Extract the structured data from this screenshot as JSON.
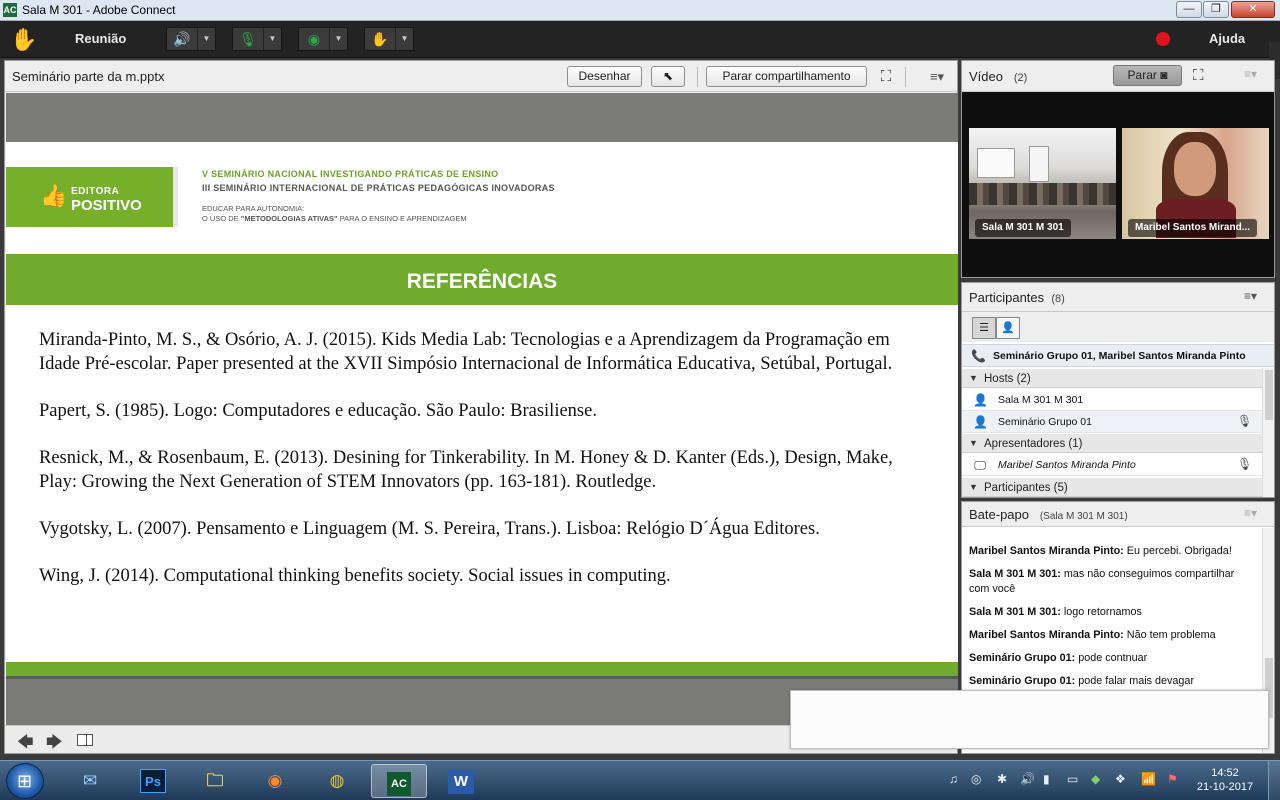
{
  "window": {
    "icon_text": "AC",
    "title": "Sala M 301 - Adobe Connect",
    "minimize": "—",
    "maximize": "❐",
    "close": "✕"
  },
  "menubar": {
    "meeting_menu": "Reunião",
    "help_menu": "Ajuda",
    "icons": [
      "speaker-icon",
      "microphone-icon",
      "webcam-icon",
      "raise-hand-icon"
    ],
    "accent": "#2ea84a",
    "record_color": "#e0141e"
  },
  "share_pod": {
    "title": "Seminário parte da m.pptx",
    "draw_button": "Desenhar",
    "stop_sharing_button": "Parar compartilhamento",
    "slide": {
      "logo_top": "EDITORA",
      "logo_bottom": "POSITIVO",
      "header_line1": "V SEMINÁRIO NACIONAL INVESTIGANDO PRÁTICAS DE ENSINO",
      "header_line2": "III SEMINÁRIO INTERNACIONAL DE PRÁTICAS PEDAGÓGICAS INOVADORAS",
      "header_line3": "EDUCAR PARA AUTONOMIA:",
      "header_line4_pre": "O USO DE ",
      "header_line4_bold": "\"METODOLOGIAS ATIVAS\"",
      "header_line4_post": " PARA O ENSINO E APRENDIZAGEM",
      "section_title": "REFERÊNCIAS",
      "references": [
        "Miranda-Pinto, M. S., & Osório, A. J. (2015). Kids Media Lab: Tecnologias e a Aprendizagem da Programação em Idade Pré-escolar. Paper presented at the XVII Simpósio Internacional de Informática Educativa, Setúbal, Portugal.",
        "Papert, S. (1985). Logo: Computadores e educação. São Paulo: Brasiliense.",
        "Resnick, M., & Rosenbaum, E. (2013). Desining for Tinkerability. In M. Honey & D. Kanter (Eds.), Design, Make, Play: Growing the Next Generation of STEM Innovators (pp. 163-181). Routledge.",
        "Vygotsky, L. (2007). Pensamento e Linguagem (M. S. Pereira, Trans.). Lisboa: Relógio D´Água Editores.",
        "Wing, J. (2014). Computational thinking benefits society. Social issues in computing."
      ],
      "brand_green": "#6fab2c"
    }
  },
  "video_pod": {
    "title": "Vídeo",
    "count": "(2)",
    "stop_button": "Parar",
    "tiles": [
      {
        "label": "Sala M 301 M 301"
      },
      {
        "label": "Maribel Santos Mirand..."
      }
    ]
  },
  "participants_pod": {
    "title": "Participantes",
    "count": "(8)",
    "speaking": "Seminário Grupo 01, Maribel Santos Miranda  Pinto",
    "groups": {
      "hosts": "Hosts (2)",
      "presenters": "Apresentadores (1)",
      "participants": "Participantes (5)"
    },
    "hosts": [
      "Sala M 301 M 301",
      "Seminário Grupo 01"
    ],
    "presenters": [
      "Maribel Santos Miranda  Pinto"
    ]
  },
  "chat_pod": {
    "title": "Bate-papo",
    "room": "(Sala M 301 M 301)",
    "messages": [
      {
        "from": "Maribel Santos Miranda  Pinto:",
        "text": " Eu percebi. Obrigada!"
      },
      {
        "from": "Sala M 301 M 301:",
        "text": " mas não conseguimos compartilhar com você"
      },
      {
        "from": "Sala M 301 M 301:",
        "text": " logo retornamos"
      },
      {
        "from": "Maribel Santos Miranda  Pinto:",
        "text": " Não tem problema"
      },
      {
        "from": "Seminário Grupo 01:",
        "text": " pode contnuar"
      },
      {
        "from": "Seminário Grupo 01:",
        "text": " pode falar mais devagar"
      }
    ]
  },
  "taskbar": {
    "apps": [
      "outlook-icon",
      "photoshop-icon",
      "file-explorer-icon",
      "firefox-icon",
      "chrome-icon",
      "adobe-connect-icon",
      "word-icon"
    ],
    "photoshop_label": "Ps",
    "word_label": "W",
    "connect_label": "AC",
    "time": "14:52",
    "date": "21-10-2017"
  }
}
